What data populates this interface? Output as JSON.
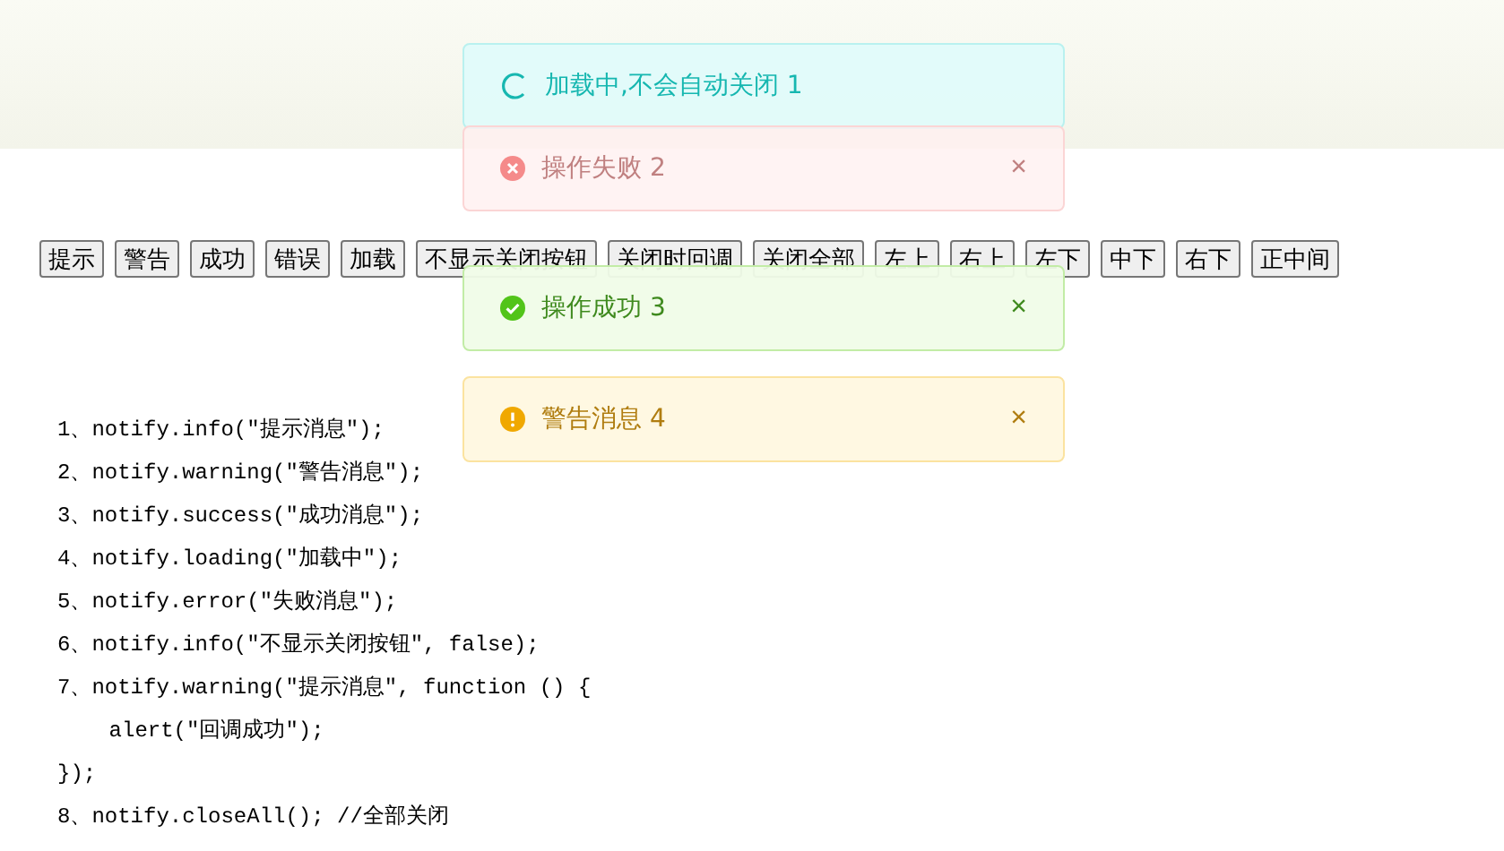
{
  "buttons": [
    {
      "label": "提示"
    },
    {
      "label": "警告"
    },
    {
      "label": "成功"
    },
    {
      "label": "错误"
    },
    {
      "label": "加载"
    },
    {
      "label": "不显示关闭按钮"
    },
    {
      "label": "关闭时回调"
    },
    {
      "label": "关闭全部"
    },
    {
      "label": "左上"
    },
    {
      "label": "右上"
    },
    {
      "label": "左下"
    },
    {
      "label": "中下"
    },
    {
      "label": "右下"
    },
    {
      "label": "正中间"
    }
  ],
  "code_lines": [
    "1、notify.info(\"提示消息\");",
    "2、notify.warning(\"警告消息\");",
    "3、notify.success(\"成功消息\");",
    "4、notify.loading(\"加载中\");",
    "5、notify.error(\"失败消息\");",
    "6、notify.info(\"不显示关闭按钮\", false);",
    "7、notify.warning(\"提示消息\", function () {",
    "    alert(\"回调成功\");",
    "});",
    "8、notify.closeAll(); //全部关闭"
  ],
  "notifications": [
    {
      "kind": "loading",
      "message": "加载中,不会自动关闭 1"
    },
    {
      "kind": "error",
      "message": "操作失败 2",
      "close": "×"
    },
    {
      "kind": "success",
      "message": "操作成功 3",
      "close": "×"
    },
    {
      "kind": "warning",
      "message": "警告消息 4",
      "close": "×"
    }
  ]
}
